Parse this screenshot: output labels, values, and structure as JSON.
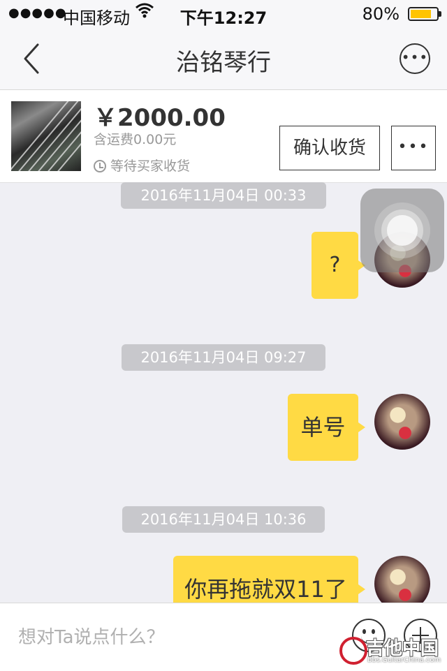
{
  "status_bar": {
    "signal": "●●●●●",
    "carrier": "中国移动",
    "time": "下午12:27",
    "battery_percent": "80%",
    "battery_level": 0.8
  },
  "nav": {
    "title": "治铭琴行",
    "back_icon": "chevron-left-icon",
    "more_icon": "ellipsis-circle-icon"
  },
  "order": {
    "price": "￥2000.00",
    "shipping": "含运费0.00元",
    "status": "等待买家收货",
    "confirm_label": "确认收货",
    "more_label": "•••"
  },
  "messages": [
    {
      "timestamp": "2016年11月04日 00:33",
      "text": "?"
    },
    {
      "timestamp": "2016年11月04日 09:27",
      "text": "单号"
    },
    {
      "timestamp": "2016年11月04日 10:36",
      "text": "你再拖就双11了"
    }
  ],
  "input": {
    "placeholder": "想对Ta说点什么？"
  },
  "watermark": {
    "title": "吉他中国",
    "url": "bbs.GuitarChina.com"
  },
  "colors": {
    "bubble": "#ffda44",
    "timestamp_bg": "#c8c8cc",
    "chat_bg": "#efeff4",
    "battery": "#ffc400"
  }
}
